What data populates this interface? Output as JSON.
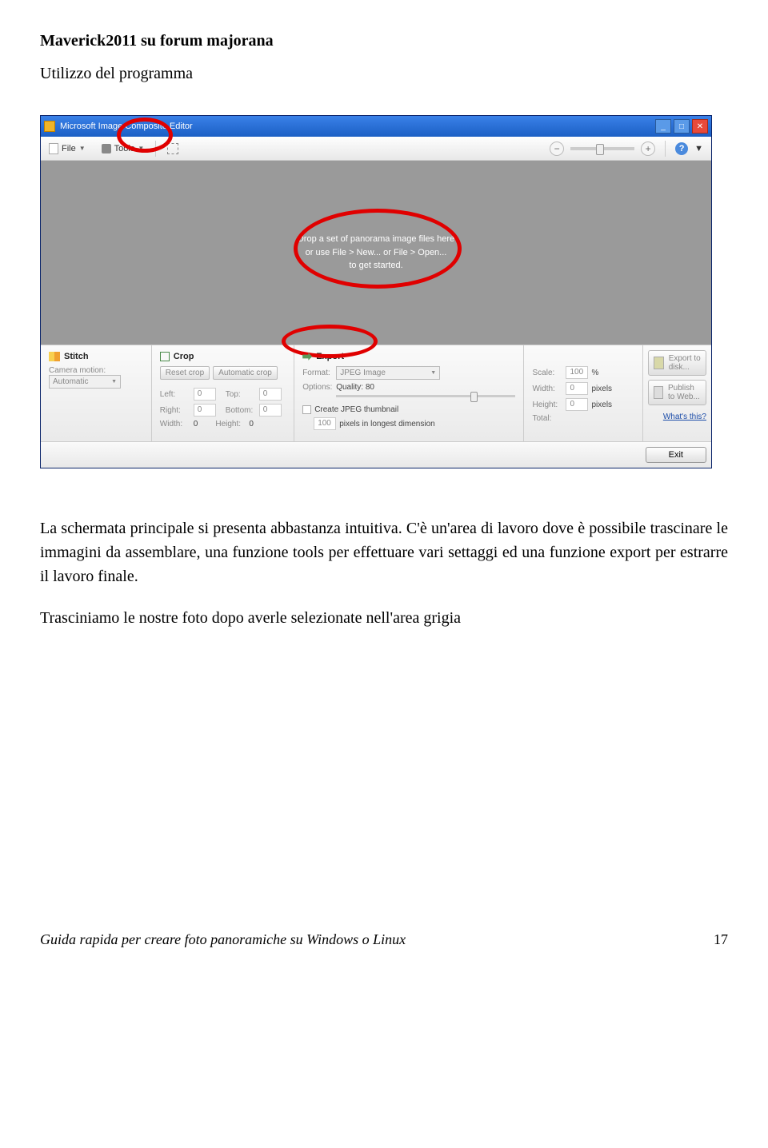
{
  "doc": {
    "header": "Maverick2011 su forum majorana",
    "subtitle": "Utilizzo del programma",
    "para1": "La schermata principale si presenta abbastanza intuitiva. C'è un'area di lavoro dove è possibile trascinare le immagini da assemblare, una funzione tools per effettuare vari settaggi ed una funzione export per estrarre il lavoro finale.",
    "para2": "Trasciniamo le nostre foto dopo averle selezionate nell'area grigia",
    "footer": "Guida rapida per creare foto panoramiche su Windows o Linux",
    "page_num": "17"
  },
  "app": {
    "title": "Microsoft Image Composite Editor",
    "menu": {
      "file": "File",
      "tools": "Tools"
    },
    "drop_line1": "Drop a set of panorama image files here",
    "drop_line2": "or use File > New... or File > Open...",
    "drop_line3": "to get started.",
    "stitch": {
      "title": "Stitch",
      "camera_motion": "Camera motion:",
      "camera_value": "Automatic"
    },
    "crop": {
      "title": "Crop",
      "reset": "Reset crop",
      "auto": "Automatic crop",
      "left": "Left:",
      "top": "Top:",
      "right": "Right:",
      "bottom": "Bottom:",
      "width": "Width:",
      "height": "Height:",
      "zero": "0"
    },
    "export": {
      "title": "Export",
      "format": "Format:",
      "format_value": "JPEG Image",
      "options": "Options:",
      "quality": "Quality: 80",
      "thumb": "Create JPEG thumbnail",
      "thumb_val": "100",
      "thumb_suffix": "pixels in longest dimension"
    },
    "size": {
      "scale": "Scale:",
      "scale_val": "100",
      "pct": "%",
      "width": "Width:",
      "height": "Height:",
      "pixels": "pixels",
      "total": "Total:",
      "zero": "0"
    },
    "right": {
      "export_disk": "Export to disk...",
      "publish": "Publish to Web...",
      "whats": "What's this?"
    },
    "exit": "Exit"
  }
}
